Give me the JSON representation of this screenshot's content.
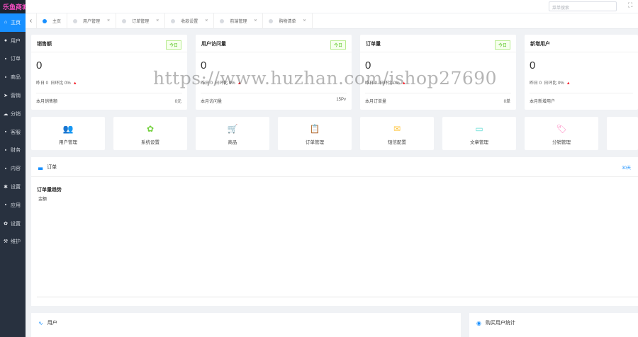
{
  "sidebar": {
    "logo": "乐鱼商城",
    "items": [
      {
        "label": "主页",
        "icon": "home-icon",
        "glyph": "⌂",
        "active": true
      },
      {
        "label": "用户",
        "icon": "user-icon",
        "glyph": "●"
      },
      {
        "label": "订单",
        "icon": "cart-icon",
        "glyph": "▪"
      },
      {
        "label": "商品",
        "icon": "goods-icon",
        "glyph": "▪"
      },
      {
        "label": "营销",
        "icon": "send-icon",
        "glyph": "➤"
      },
      {
        "label": "分销",
        "icon": "cloud-icon",
        "glyph": "☁"
      },
      {
        "label": "客服",
        "icon": "chat-icon",
        "glyph": "▪"
      },
      {
        "label": "财务",
        "icon": "money-icon",
        "glyph": "▪"
      },
      {
        "label": "内容",
        "icon": "document-icon",
        "glyph": "▪"
      },
      {
        "label": "设置",
        "icon": "gear-icon",
        "glyph": "✱"
      },
      {
        "label": "应用",
        "icon": "app-icon",
        "glyph": "▪"
      },
      {
        "label": "设置",
        "icon": "settings-icon",
        "glyph": "✿"
      },
      {
        "label": "维护",
        "icon": "wrench-icon",
        "glyph": "⚒"
      }
    ]
  },
  "header": {
    "search_placeholder": "菜单搜索",
    "fullscreen_icon": "⛶"
  },
  "tabs": {
    "back_icon": "‹",
    "items": [
      {
        "label": "主页",
        "active": true,
        "closable": false
      },
      {
        "label": "用户管理",
        "closable": true
      },
      {
        "label": "订单管理",
        "closable": true
      },
      {
        "label": "收款设置",
        "closable": true
      },
      {
        "label": "前端管理",
        "closable": true
      },
      {
        "label": "购物清单",
        "closable": true
      }
    ],
    "close_icon": "×"
  },
  "stats": [
    {
      "title": "销售额",
      "badge": "今日",
      "value": "0",
      "yesterday": "昨日 0",
      "ratio": "日环比 0%",
      "foot_label": "本月销售额",
      "foot_value": "0元"
    },
    {
      "title": "用户访问量",
      "badge": "今日",
      "value": "0",
      "yesterday": "昨日 0",
      "ratio": "日环比 0%",
      "foot_label": "本月访问量",
      "foot_value": "15Pv"
    },
    {
      "title": "订单量",
      "badge": "今日",
      "value": "0",
      "yesterday": "昨日 0",
      "ratio": "日环比 0%",
      "foot_label": "本月订单量",
      "foot_value": "0单"
    },
    {
      "title": "新增用户",
      "badge": "今日",
      "value": "0",
      "yesterday": "昨日 0",
      "ratio": "日环比 0%",
      "foot_label": "本月新增用户",
      "foot_value": ""
    }
  ],
  "stat_up_arrow": "▲",
  "quick": [
    {
      "label": "用户管理",
      "icon": "users-icon",
      "glyph": "👥",
      "color": "#69b1ff"
    },
    {
      "label": "系统设置",
      "icon": "gear-icon",
      "glyph": "✿",
      "color": "#73d13d"
    },
    {
      "label": "商品",
      "icon": "cart-icon",
      "glyph": "🛒",
      "color": "#ff9c6e"
    },
    {
      "label": "订单管理",
      "icon": "clipboard-icon",
      "glyph": "📋",
      "color": "#b37feb"
    },
    {
      "label": "短信配置",
      "icon": "mail-icon",
      "glyph": "✉",
      "color": "#ffc53d"
    },
    {
      "label": "文章管理",
      "icon": "card-icon",
      "glyph": "▭",
      "color": "#5cdbd3"
    },
    {
      "label": "分销管理",
      "icon": "tag-icon",
      "glyph": "🏷",
      "color": "#ff85c0"
    }
  ],
  "order_panel": {
    "icon": "chart-icon",
    "glyph": "▃",
    "title": "订单",
    "range": "30天",
    "chart_title": "订单量趋势",
    "legend": "金额"
  },
  "user_panel": {
    "icon": "pulse-icon",
    "glyph": "∿",
    "title": "用户"
  },
  "buy_panel": {
    "icon": "buy-icon",
    "glyph": "◉",
    "title": "购买用户统计"
  },
  "watermark": "https://www.huzhan.com/ishop27690",
  "colors": {
    "accent": "#1890ff",
    "sidebar": "#28313f",
    "badge": "#52c41a",
    "up": "#f5222d"
  }
}
